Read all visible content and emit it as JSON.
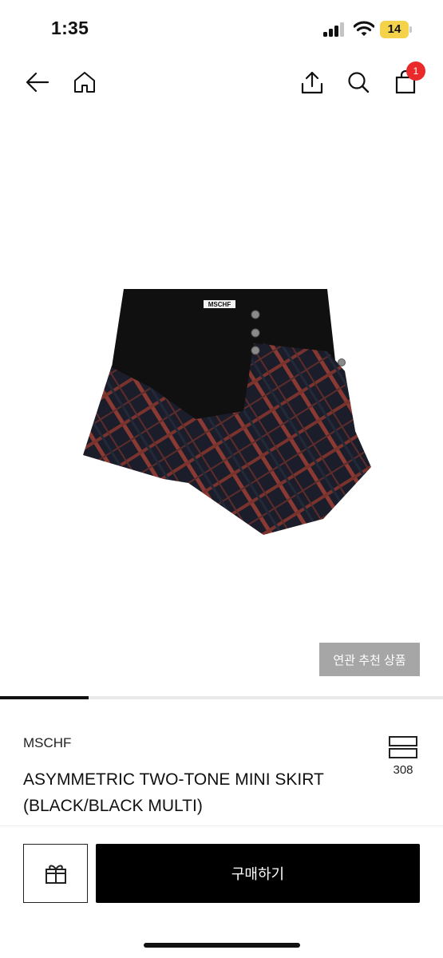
{
  "status_bar": {
    "time": "1:35",
    "battery_level": "14",
    "battery_color": "#f4d24a",
    "icons": [
      "signal-icon",
      "wifi-icon",
      "battery-icon"
    ]
  },
  "nav": {
    "icons": [
      "back-arrow-icon",
      "home-icon",
      "share-icon",
      "search-icon",
      "shopping-bag-icon"
    ],
    "cart_badge": "1",
    "badge_color": "#ea2a2a"
  },
  "product_image": {
    "logo_text": "MSCHF",
    "colors": {
      "waistband": "#101010",
      "plaid_base": "#1b1d2a",
      "plaid_stripe": "#8a3a32"
    }
  },
  "related_button": {
    "label": "연관 추천 상품"
  },
  "gallery": {
    "position_fraction": 0.2
  },
  "product": {
    "brand": "MSCHF",
    "title": "ASYMMETRIC TWO-TONE MINI SKIRT (BLACK/BLACK MULTI)",
    "likes_count": "308",
    "likes_icon": "layers-icon"
  },
  "bottom_bar": {
    "gift_icon": "gift-icon",
    "buy_label": "구매하기"
  }
}
